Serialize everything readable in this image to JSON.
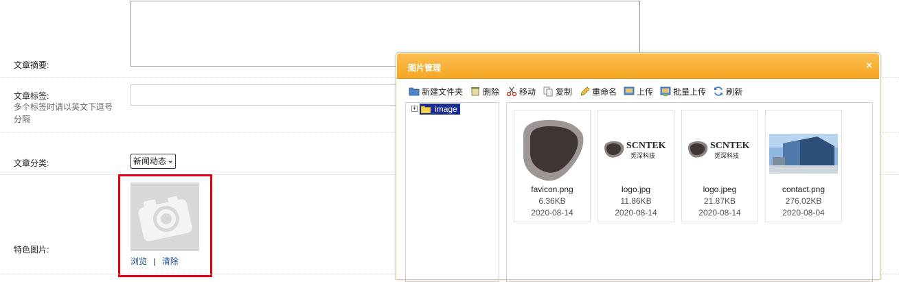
{
  "form": {
    "summary_label": "文章摘要:",
    "tags_label": "文章标签:",
    "tags_hint": "多个标签时请以英文下逗号分隔",
    "category_label": "文章分类:",
    "category_value": "新闻动态",
    "feature_label": "特色图片:",
    "browse_link": "浏览",
    "separator": "|",
    "clear_link": "清除"
  },
  "dialog": {
    "title": "图片管理",
    "close": "×",
    "toolbar": {
      "new_folder": "新建文件夹",
      "delete": "删除",
      "move": "移动",
      "copy": "复制",
      "rename": "重命名",
      "upload": "上传",
      "batch_upload": "批量上传",
      "refresh": "刷新"
    },
    "tree": {
      "expander": "+",
      "root": "image"
    },
    "files": [
      {
        "name": "favicon.png",
        "size": "6.36KB",
        "date": "2020-08-14"
      },
      {
        "name": "logo.jpg",
        "size": "11.86KB",
        "date": "2020-08-14"
      },
      {
        "name": "logo.jpeg",
        "size": "21.87KB",
        "date": "2020-08-14"
      },
      {
        "name": "contact.png",
        "size": "276.02KB",
        "date": "2020-08-04"
      }
    ],
    "logo_text": {
      "brand": "SCNTEK",
      "sub": "觅深科技"
    }
  },
  "colors": {
    "dialog_header": "#f5a623",
    "highlight_outline": "#e60012",
    "tree_selected": "#1c2d92",
    "link": "#1a4f9c"
  },
  "icons": [
    "folder-icon",
    "delete-icon",
    "scissors-icon",
    "copy-icon",
    "pencil-icon",
    "upload-icon",
    "batch-upload-icon",
    "refresh-icon",
    "camera-icon"
  ]
}
